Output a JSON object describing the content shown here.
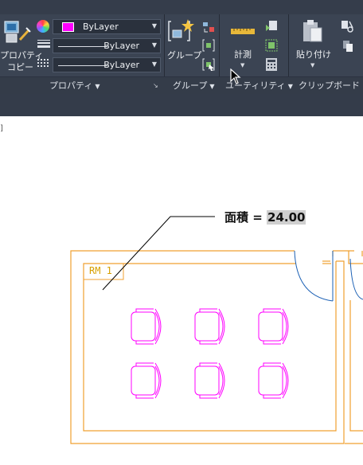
{
  "ribbon": {
    "properties": {
      "match_label_line1": "プロパティ",
      "match_label_line2": "コピー",
      "color_value": "ByLayer",
      "color_swatch": "#ff00ff",
      "lineweight_value": "ByLayer",
      "linetype_value": "ByLayer",
      "panel_title": "プロパティ"
    },
    "groups": {
      "group_label": "グループ",
      "panel_title": "グループ"
    },
    "utilities": {
      "measure_label": "計測",
      "panel_title": "ユーティリティ"
    },
    "clipboard": {
      "paste_label": "貼り付け",
      "panel_title": "クリップボード"
    }
  },
  "drawing": {
    "bracket_text": "]",
    "area_label": "面積 = ",
    "area_value": "24.00",
    "room_tag": "RM  1",
    "colors": {
      "walls": "#f0a030",
      "chairs": "#ff00ff",
      "doors": "#1a5fb4",
      "leader": "#000000",
      "room_tag": "#d7a000"
    },
    "icons": [
      "chair-icon",
      "door-swing-icon"
    ]
  }
}
